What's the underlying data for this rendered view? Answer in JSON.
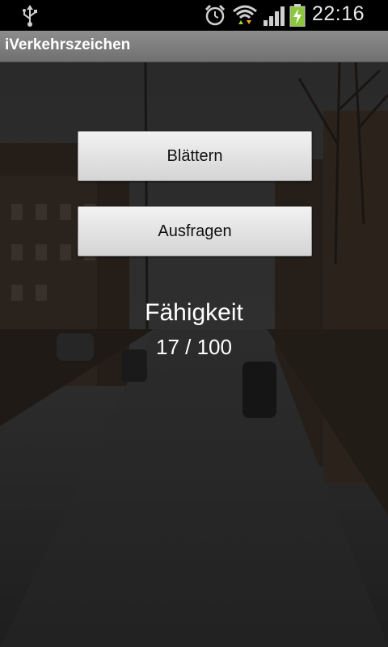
{
  "status_bar": {
    "time": "22:16",
    "icons": [
      "usb-icon",
      "alarm-icon",
      "wifi-icon",
      "signal-icon",
      "battery-charging-icon"
    ]
  },
  "app": {
    "title": "iVerkehrszeichen"
  },
  "main": {
    "browse_label": "Blättern",
    "quiz_label": "Ausfragen",
    "ability_label": "Fähigkeit",
    "ability_value": "17 / 100"
  },
  "colors": {
    "status_bar_bg": "#000000",
    "title_bar_bg": "#7f7f7f",
    "button_bg": "#e6e6e6",
    "text_light": "#ffffff",
    "battery_green": "#8cc63f"
  }
}
